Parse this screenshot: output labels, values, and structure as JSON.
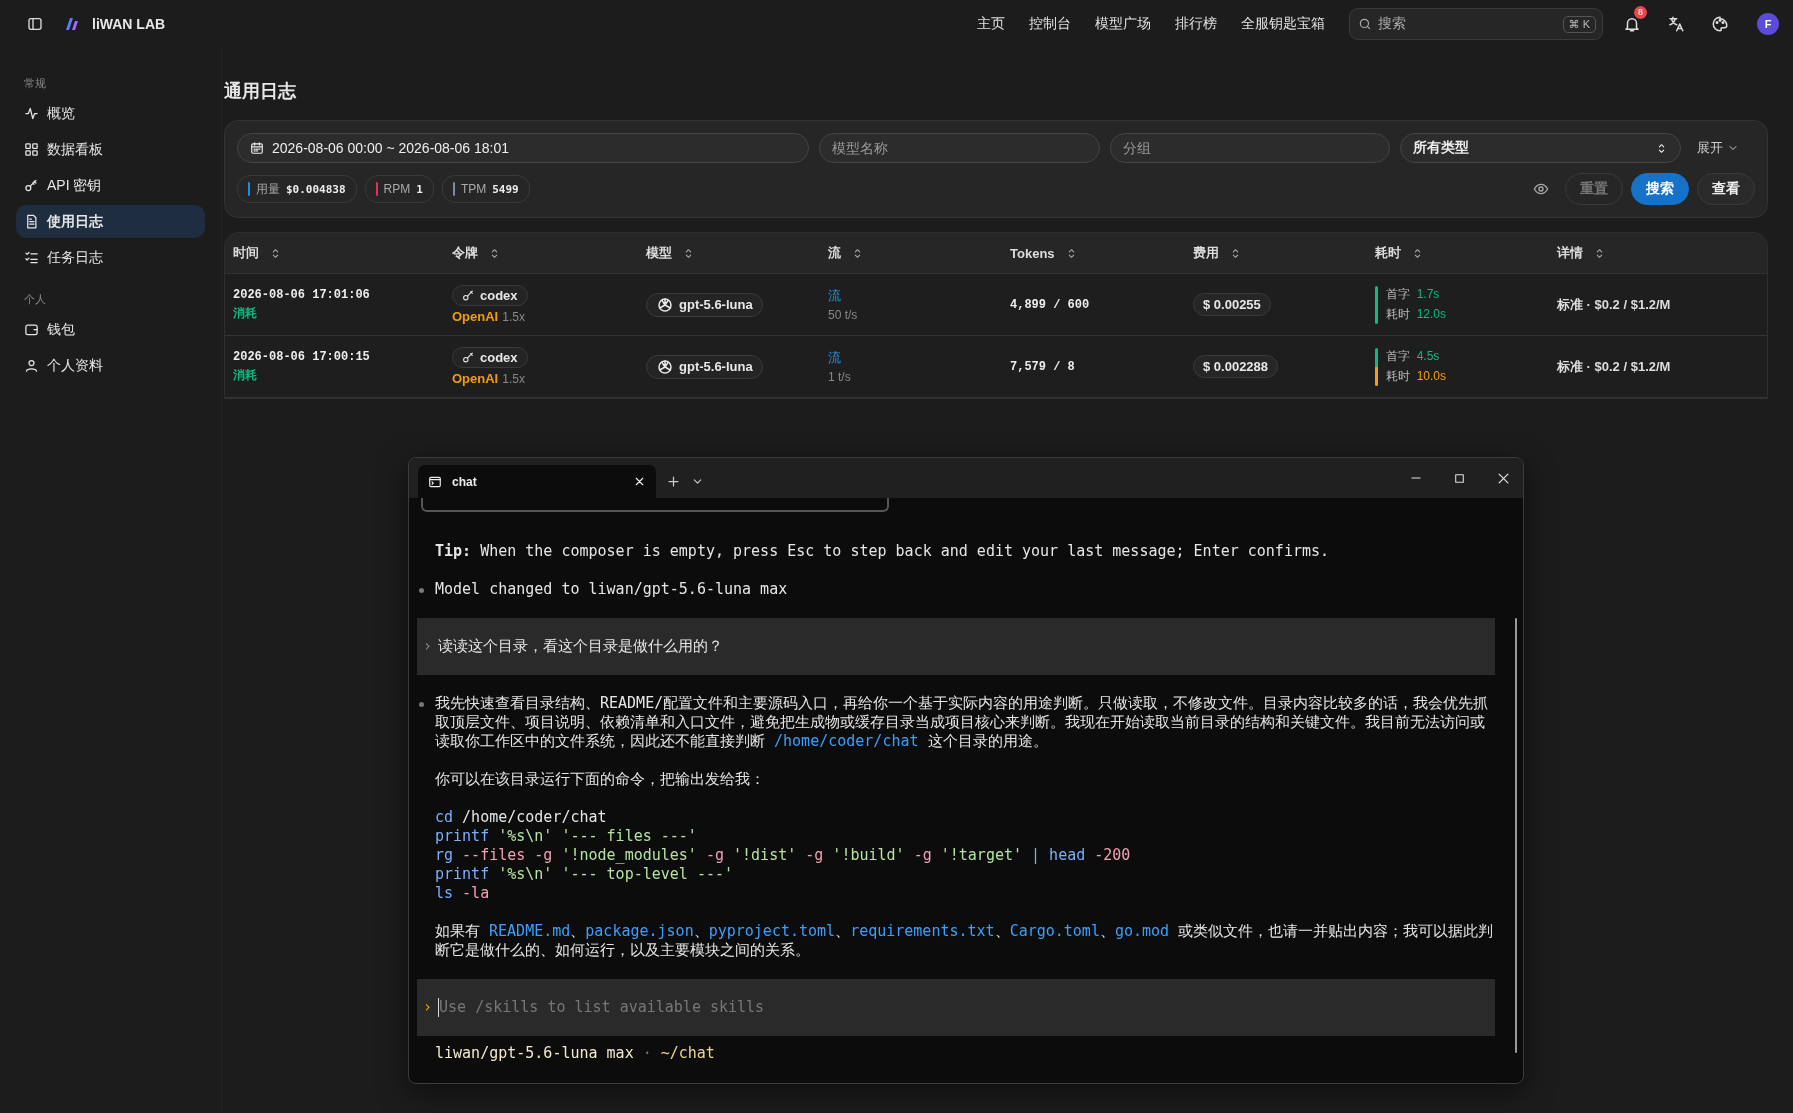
{
  "topbar": {
    "brand": "liWAN LAB",
    "nav": [
      {
        "label": "主页"
      },
      {
        "label": "控制台"
      },
      {
        "label": "模型广场"
      },
      {
        "label": "排行榜"
      },
      {
        "label": "全服钥匙宝箱"
      }
    ],
    "search": {
      "placeholder": "搜索",
      "shortcut": "⌘ K"
    },
    "notification_count": "8",
    "avatar": "F"
  },
  "sidebar": [
    {
      "heading": "常规",
      "items": [
        {
          "label": "概览",
          "selected": false
        },
        {
          "label": "数据看板",
          "selected": false
        },
        {
          "label": "API 密钥",
          "selected": false
        },
        {
          "label": "使用日志",
          "selected": true
        },
        {
          "label": "任务日志",
          "selected": false
        }
      ]
    },
    {
      "heading": "个人",
      "items": [
        {
          "label": "钱包",
          "selected": false
        },
        {
          "label": "个人资料",
          "selected": false
        }
      ]
    }
  ],
  "page_title": "通用日志",
  "filters": {
    "date_range": "2026-08-06 00:00 ~ 2026-08-06 18:01",
    "model_name": {
      "placeholder": "模型名称"
    },
    "group": {
      "placeholder": "分组"
    },
    "type": {
      "value": "所有类型"
    },
    "expand": "展开",
    "stats": [
      {
        "label": "用量",
        "value": "$0.004838",
        "color": "#1d8fe0"
      },
      {
        "label": "RPM",
        "value": "1",
        "color": "#e0325a"
      },
      {
        "label": "TPM",
        "value": "5499",
        "color": "#7a8aa0"
      }
    ],
    "buttons": [
      {
        "label": "重置",
        "kind": "ghost"
      },
      {
        "label": "搜索",
        "kind": "primary"
      },
      {
        "label": "查看",
        "kind": "outline"
      }
    ]
  },
  "table": {
    "columns": [
      "时间",
      "令牌",
      "模型",
      "流",
      "Tokens",
      "费用",
      "耗时",
      "详情"
    ],
    "rows": [
      {
        "time": "2026-08-06 17:01:06",
        "type": "消耗",
        "token": "codex",
        "group": "OpenAI",
        "ratio": "1.5x",
        "model": "gpt-5.6-luna",
        "stream": "流",
        "speed": "50 t/s",
        "tokens": "4,899 / 600",
        "cost": "$ 0.00255",
        "timing": [
          {
            "label": "首字",
            "value": "1.7s",
            "color": "#10b981"
          },
          {
            "label": "耗时",
            "value": "12.0s",
            "color": "#10b981"
          }
        ],
        "detail": "标准 · $0.2 / $1.2/M"
      },
      {
        "time": "2026-08-06 17:00:15",
        "type": "消耗",
        "token": "codex",
        "group": "OpenAI",
        "ratio": "1.5x",
        "model": "gpt-5.6-luna",
        "stream": "流",
        "speed": "1 t/s",
        "tokens": "7,579 / 8",
        "cost": "$ 0.002288",
        "timing": [
          {
            "label": "首字",
            "value": "4.5s",
            "color": "#10b981"
          },
          {
            "label": "耗时",
            "value": "10.0s",
            "color": "#f59e0b"
          }
        ],
        "detail": "标准 · $0.2 / $1.2/M"
      }
    ]
  },
  "terminal": {
    "tab": "chat",
    "lines": [
      {
        "kind": "tip",
        "text": "**Tip:** When the composer is empty, press Esc to step back and edit your last message; Enter confirms."
      },
      {
        "kind": "bullet",
        "segments": [
          {
            "kind": "plain",
            "text": "Model changed to liwan/gpt-5.6-luna max"
          }
        ]
      },
      {
        "kind": "prompt",
        "marker": "›",
        "text": "读读这个目录，看这个目录是做什么用的？"
      },
      {
        "kind": "bullet",
        "segments": [
          {
            "kind": "plain",
            "text": "我先快速查看目录结构、README/配置文件和主要源码入口，再给你一个基于实际内容的用途判断。只做读取，不修改文件。目录内容比较多的话，我会优先抓取顶层文件、项目说明、依赖清单和入口文件，避免把生成物或缓存目录当成项目核心来判断。我现在开始读取当前目录的结构和关键文件。我目前无法访问或读取你工作区中的文件系统，因此还不能直接判断 "
          },
          {
            "kind": "link",
            "text": "/home/coder/chat"
          },
          {
            "kind": "plain",
            "text": " 这个目录的用途。"
          }
        ]
      },
      {
        "kind": "text",
        "segments": [
          {
            "kind": "plain",
            "text": "你可以在该目录运行下面的命令，把输出发给我："
          }
        ]
      },
      {
        "kind": "code",
        "lines": [
          [
            {
              "kind": "cmd",
              "text": "cd"
            },
            {
              "kind": "plain",
              "text": " /home/coder/chat"
            }
          ],
          [
            {
              "kind": "cmd",
              "text": "printf"
            },
            {
              "kind": "str",
              "text": " '%s\\n' '--- files ---'"
            }
          ],
          [
            {
              "kind": "cmd",
              "text": "rg"
            },
            {
              "kind": "flag",
              "text": " --files -g"
            },
            {
              "kind": "str",
              "text": " '!node_modules'"
            },
            {
              "kind": "flag",
              "text": " -g"
            },
            {
              "kind": "str",
              "text": " '!dist'"
            },
            {
              "kind": "flag",
              "text": " -g"
            },
            {
              "kind": "str",
              "text": " '!build'"
            },
            {
              "kind": "flag",
              "text": " -g"
            },
            {
              "kind": "str",
              "text": " '!target'"
            },
            {
              "kind": "cmd",
              "text": " | head"
            },
            {
              "kind": "flag",
              "text": " -200"
            }
          ],
          [
            {
              "kind": "cmd",
              "text": "printf"
            },
            {
              "kind": "str",
              "text": " '%s\\n' '--- top-level ---'"
            }
          ],
          [
            {
              "kind": "cmd",
              "text": "ls"
            },
            {
              "kind": "flag",
              "text": " -la"
            }
          ]
        ]
      },
      {
        "kind": "text",
        "segments": [
          {
            "kind": "plain",
            "text": "如果有 "
          },
          {
            "kind": "link",
            "text": "README.md"
          },
          {
            "kind": "plain",
            "text": "、"
          },
          {
            "kind": "link",
            "text": "package.json"
          },
          {
            "kind": "plain",
            "text": "、"
          },
          {
            "kind": "link",
            "text": "pyproject.toml"
          },
          {
            "kind": "plain",
            "text": "、"
          },
          {
            "kind": "link",
            "text": "requirements.txt"
          },
          {
            "kind": "plain",
            "text": "、"
          },
          {
            "kind": "link",
            "text": "Cargo.toml"
          },
          {
            "kind": "plain",
            "text": "、"
          },
          {
            "kind": "link",
            "text": "go.mod"
          },
          {
            "kind": "plain",
            "text": " 或类似文件，也请一并贴出内容；我可以据此判断它是做什么的、如何运行，以及主要模块之间的关系。"
          }
        ]
      }
    ],
    "input": {
      "marker": "›",
      "placeholder": "Use /skills to list available skills"
    },
    "status": {
      "model": "liwan/gpt-5.6-luna max",
      "separator": "·",
      "path": "~/chat"
    }
  }
}
